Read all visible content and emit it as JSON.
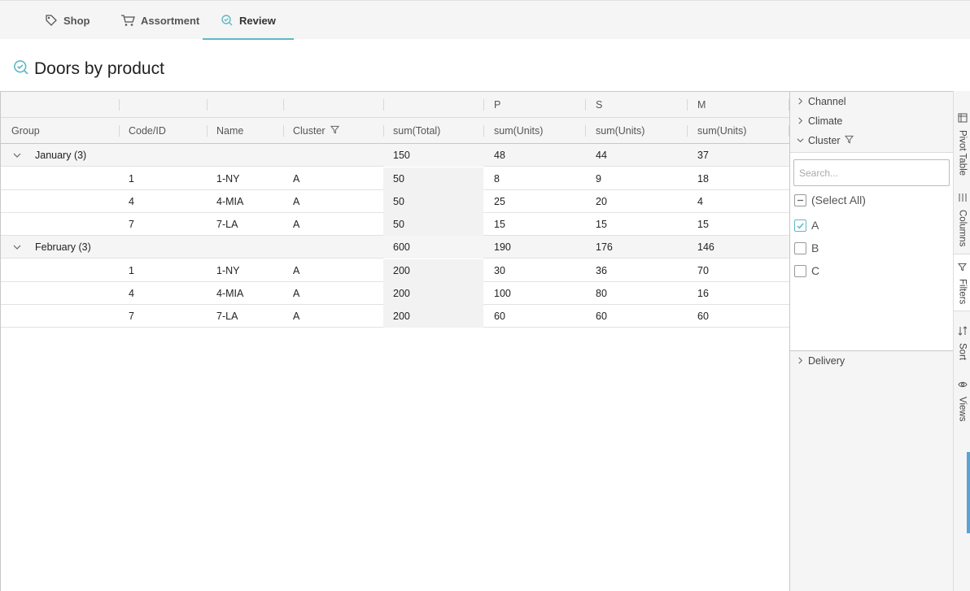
{
  "nav": {
    "tabs": [
      {
        "label": "Shop",
        "icon": "tag-icon"
      },
      {
        "label": "Assortment",
        "icon": "cart-icon"
      },
      {
        "label": "Review",
        "icon": "review-icon",
        "active": true
      }
    ]
  },
  "page": {
    "title": "Doors by product"
  },
  "grid": {
    "group_headers": [
      "",
      "",
      "",
      "",
      "",
      "P",
      "S",
      "M"
    ],
    "columns": [
      "Group",
      "Code/ID",
      "Name",
      "Cluster",
      "sum(Total)",
      "sum(Units)",
      "sum(Units)",
      "sum(Units)"
    ],
    "groups": [
      {
        "label": "January (3)",
        "totals": [
          "150",
          "48",
          "44",
          "37"
        ],
        "rows": [
          [
            "1",
            "1-NY",
            "A",
            "50",
            "8",
            "9",
            "18"
          ],
          [
            "4",
            "4-MIA",
            "A",
            "50",
            "25",
            "20",
            "4"
          ],
          [
            "7",
            "7-LA",
            "A",
            "50",
            "15",
            "15",
            "15"
          ]
        ]
      },
      {
        "label": "February (3)",
        "totals": [
          "600",
          "190",
          "176",
          "146"
        ],
        "rows": [
          [
            "1",
            "1-NY",
            "A",
            "200",
            "30",
            "36",
            "70"
          ],
          [
            "4",
            "4-MIA",
            "A",
            "200",
            "100",
            "80",
            "16"
          ],
          [
            "7",
            "7-LA",
            "A",
            "200",
            "60",
            "60",
            "60"
          ]
        ]
      }
    ]
  },
  "filters": {
    "sections": [
      "Channel",
      "Climate",
      "Cluster",
      "Delivery"
    ],
    "search_placeholder": "Search...",
    "select_all": "(Select All)",
    "options": [
      {
        "label": "A",
        "checked": true
      },
      {
        "label": "B",
        "checked": false
      },
      {
        "label": "C",
        "checked": false
      }
    ]
  },
  "side_tabs": [
    "Pivot Table",
    "Columns",
    "Filters",
    "Sort",
    "Views"
  ],
  "colors": {
    "accent": "#5fb8c5",
    "scroll": "#5aa3d6"
  }
}
